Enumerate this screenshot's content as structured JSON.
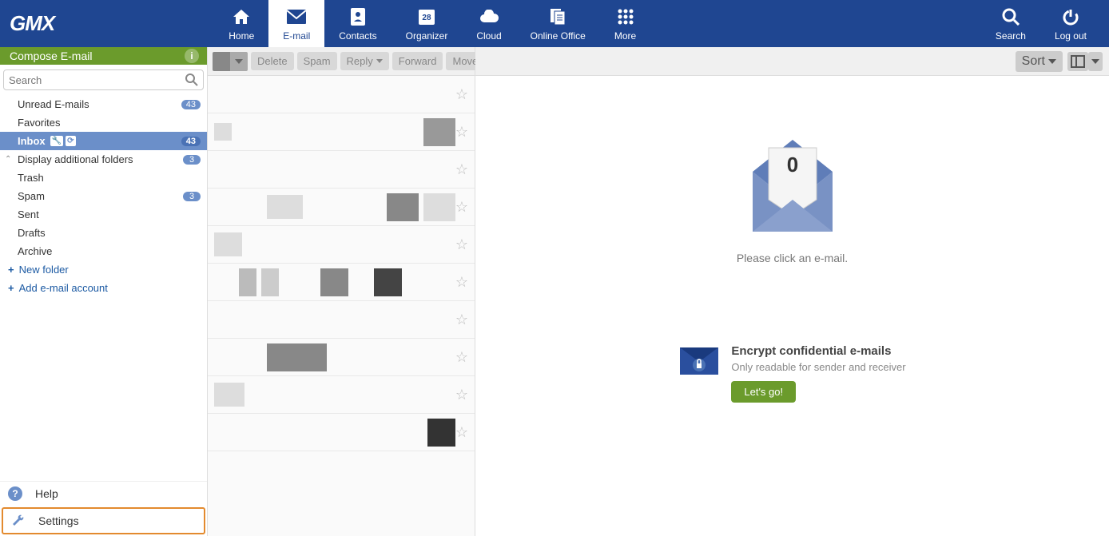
{
  "brand": "GMX",
  "nav": {
    "home": "Home",
    "email": "E-mail",
    "contacts": "Contacts",
    "organizer": "Organizer",
    "organizer_day": "28",
    "cloud": "Cloud",
    "office": "Online Office",
    "more": "More",
    "search": "Search",
    "logout": "Log out"
  },
  "compose": "Compose E-mail",
  "search_placeholder": "Search",
  "folders": {
    "unread": {
      "label": "Unread E-mails",
      "count": "43"
    },
    "favorites": {
      "label": "Favorites"
    },
    "inbox": {
      "label": "Inbox",
      "count": "43"
    },
    "additional": {
      "label": "Display additional folders",
      "count": "3"
    },
    "trash": {
      "label": "Trash"
    },
    "spam": {
      "label": "Spam",
      "count": "3"
    },
    "sent": {
      "label": "Sent"
    },
    "drafts": {
      "label": "Drafts"
    },
    "archive": {
      "label": "Archive"
    },
    "new_folder": "New folder",
    "add_account": "Add e-mail account"
  },
  "bottom": {
    "help": "Help",
    "settings": "Settings"
  },
  "toolbar": {
    "delete": "Delete",
    "spam": "Spam",
    "reply": "Reply",
    "forward": "Forward",
    "move": "Move",
    "sort": "Sort"
  },
  "reading": {
    "count": "0",
    "message": "Please click an e-mail.",
    "encrypt_title": "Encrypt confidential e-mails",
    "encrypt_sub": "Only readable for sender and receiver",
    "encrypt_cta": "Let's go!"
  }
}
